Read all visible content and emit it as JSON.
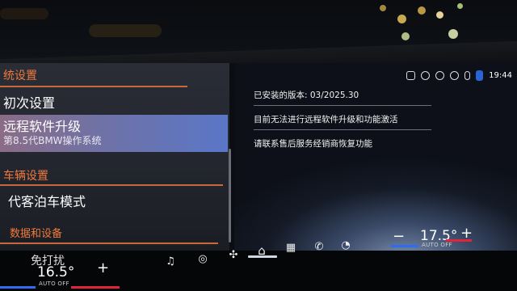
{
  "left_menu": {
    "system_header": "统设置",
    "initial_setup": "初次设置",
    "selected": {
      "title": "远程软件升级",
      "subtitle": "第8.5代BMW操作系统"
    },
    "vehicle_header": "车辆设置",
    "valet_mode": "代客泊车模式",
    "data_header": "数据和设备",
    "partial_item": "免打扰"
  },
  "right_panel": {
    "installed_version": "已安装的版本: 03/2025.30",
    "message_1": "目前无法进行远程软件升级和功能激活",
    "message_2": "请联系售后服务经销商恢复功能"
  },
  "status_bar": {
    "time": "19:44",
    "icons": [
      "phone-icon",
      "mute-icon",
      "connected-icon",
      "wifi-icon",
      "microphone-icon",
      "battery-icon"
    ]
  },
  "climate": {
    "left_temp": "16.5°",
    "left_mode": "AUTO OFF",
    "right_temp": "17.5°",
    "right_mode": "AUTO OFF",
    "minus": "−",
    "plus": "+"
  },
  "dock": {
    "icons": [
      "media-icon",
      "steering-icon",
      "fan-icon",
      "home-icon",
      "apps-icon",
      "phone-icon",
      "navigation-icon"
    ]
  },
  "colors": {
    "accent_orange": "#f07a3c",
    "selected_gradient_end": "#5a77c8",
    "temp_blue": "#2f6df0",
    "temp_red": "#e0243a"
  }
}
